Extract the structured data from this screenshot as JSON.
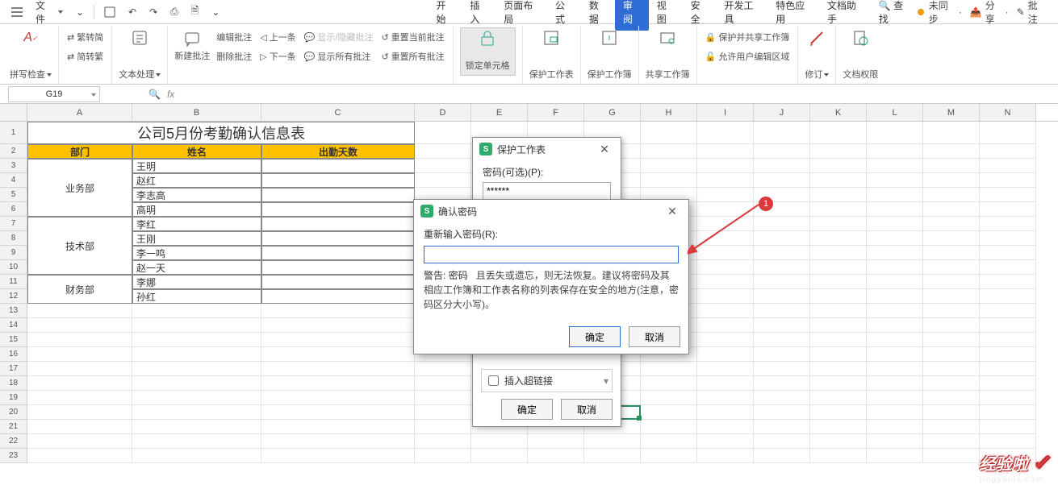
{
  "menubar": {
    "file": "文件",
    "tabs": [
      "开始",
      "插入",
      "页面布局",
      "公式",
      "数据",
      "审阅",
      "视图",
      "安全",
      "开发工具",
      "特色应用",
      "文档助手"
    ],
    "active_tab": "审阅",
    "search": "查找",
    "unsync": "未同步",
    "share": "分享",
    "comment": "批注"
  },
  "ribbon": {
    "spell": "拼写检查",
    "to_simp": "繁转简",
    "to_trad": "简转繁",
    "text_proc": "文本处理",
    "new_comment": "新建批注",
    "edit_comment": "编辑批注",
    "del_comment": "删除批注",
    "prev": "上一条",
    "next": "下一条",
    "show_hide": "显示/隐藏批注",
    "show_all": "显示所有批注",
    "reset_cur": "重置当前批注",
    "reset_all": "重置所有批注",
    "lock_cells": "锁定单元格",
    "protect_sheet": "保护工作表",
    "protect_book": "保护工作簿",
    "share_book": "共享工作簿",
    "protect_share": "保护并共享工作簿",
    "allow_edit": "允许用户编辑区域",
    "track": "修订",
    "doc_perm": "文档权限"
  },
  "namebox": "G19",
  "sheet": {
    "title": "公司5月份考勤确认信息表",
    "headers": [
      "部门",
      "姓名",
      "出勤天数"
    ],
    "rows": [
      {
        "dept": "业务部",
        "name": "王明"
      },
      {
        "dept": "",
        "name": "赵红"
      },
      {
        "dept": "",
        "name": "李志高"
      },
      {
        "dept": "",
        "name": "高明"
      },
      {
        "dept": "技术部",
        "name": "李红"
      },
      {
        "dept": "",
        "name": "王刚"
      },
      {
        "dept": "",
        "name": "李一鸣"
      },
      {
        "dept": "",
        "name": "赵一天"
      },
      {
        "dept": "财务部",
        "name": "李娜"
      },
      {
        "dept": "",
        "name": "孙红"
      }
    ],
    "cols": [
      "A",
      "B",
      "C",
      "D",
      "E",
      "F",
      "G",
      "H",
      "I",
      "J",
      "K",
      "L",
      "M",
      "N"
    ]
  },
  "dlg_protect": {
    "title": "保护工作表",
    "pwd_label": "密码(可选)(P):",
    "pwd_value": "******",
    "chk_link": "插入超链接",
    "ok": "确定",
    "cancel": "取消"
  },
  "dlg_confirm": {
    "title": "确认密码",
    "label": "重新输入密码(R):",
    "warn_prefix": "警告: 密码",
    "warn_rest": "且丢失或遗忘，则无法恢复。建议将密码及其相应工作簿和工作表名称的列表保存在安全的地方(注意，密码区分大小写)。",
    "ok": "确定",
    "cancel": "取消"
  },
  "badge": "1",
  "watermark": {
    "big": "经验啦",
    "small": "jingyanla.com"
  }
}
